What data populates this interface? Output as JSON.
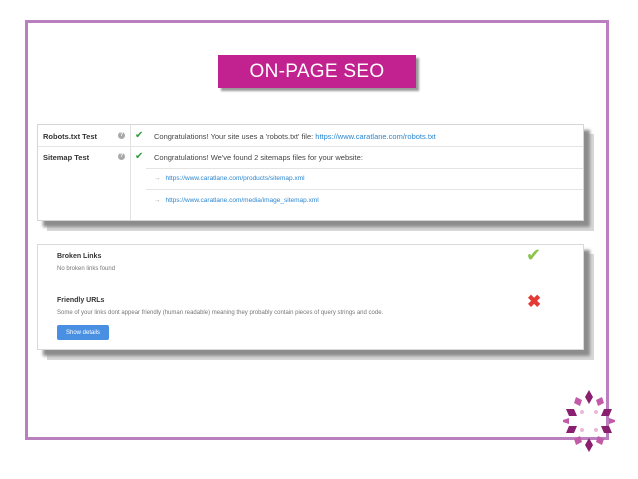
{
  "title": "ON-PAGE SEO",
  "tests": [
    {
      "label": "Robots.txt Test",
      "text": "Congratulations! Your site uses a 'robots.txt' file:",
      "link": "https://www.caratlane.com/robots.txt"
    },
    {
      "label": "Sitemap Test",
      "text": "Congratulations! We've found 2 sitemaps files for your website:"
    }
  ],
  "sitemaps": [
    "https://www.caratlane.com/products/sitemap.xml",
    "https://www.caratlane.com/media/image_sitemap.xml"
  ],
  "checks": [
    {
      "heading": "Broken Links",
      "text": "No broken links found",
      "status": "pass"
    },
    {
      "heading": "Friendly URLs",
      "text": "Some of your links dont appear friendly (human readable) meaning they probably contain pieces of query strings and code.",
      "status": "fail"
    }
  ],
  "button": "Show details",
  "icons": {
    "check": "check-icon",
    "cross": "cross-icon",
    "help": "help-icon",
    "arrow": "arrow-right-icon"
  },
  "colors": {
    "accent": "#c2228f",
    "pass": "#2e9c3c",
    "fail": "#e53935",
    "link": "#2b86d0",
    "button": "#4a90e2"
  }
}
